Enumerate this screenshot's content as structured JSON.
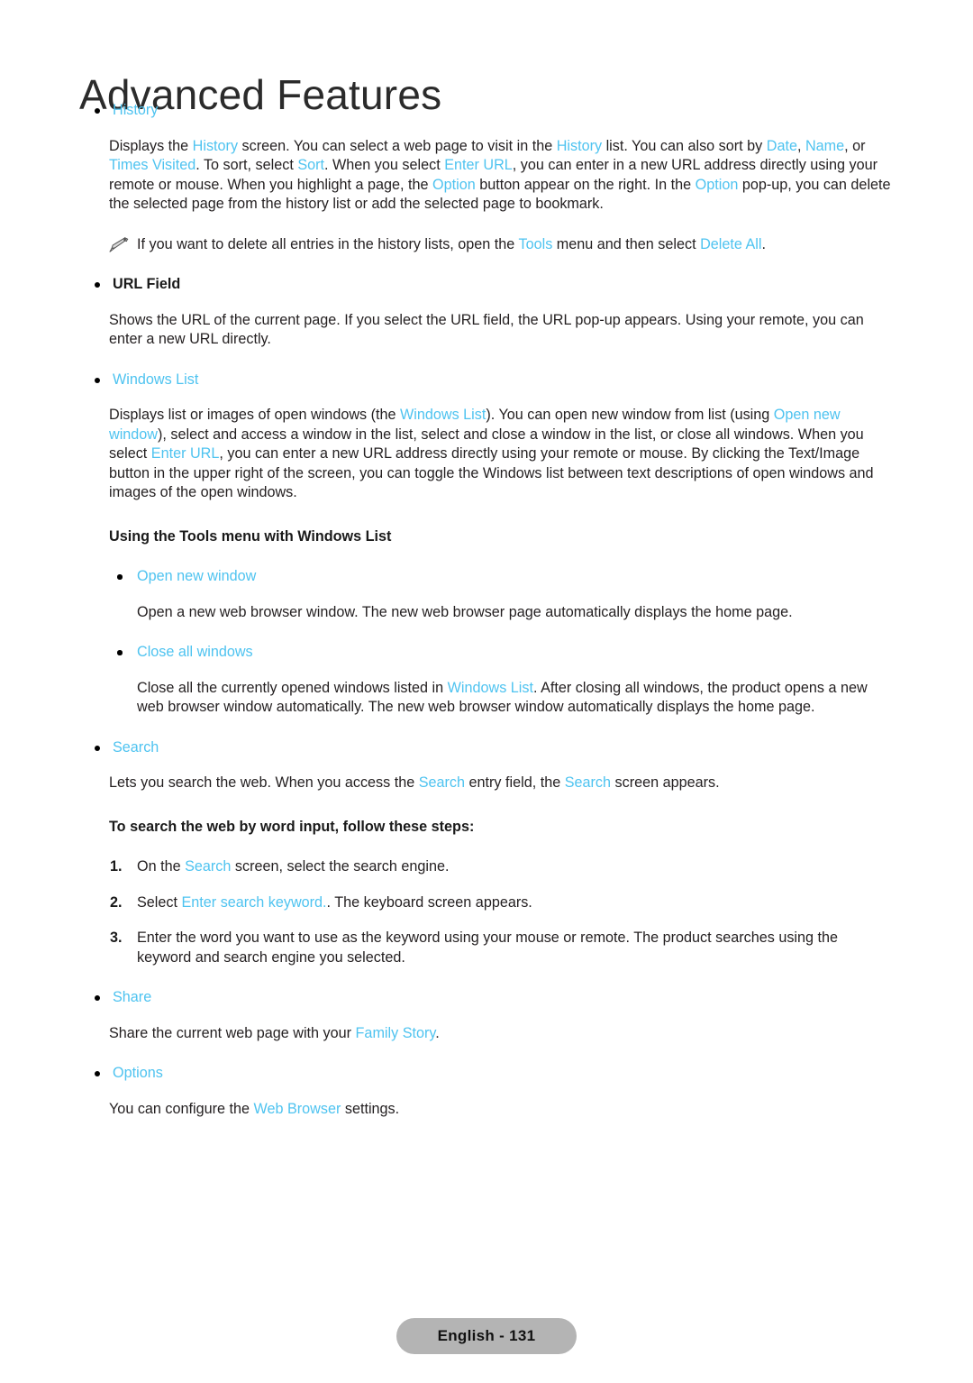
{
  "header": {
    "title": "Advanced Features"
  },
  "colors": {
    "highlight": "#4ec3f0",
    "text": "#231f20",
    "badge_bg": "#b4b4b4"
  },
  "sections": {
    "history": {
      "bullet_label": "History",
      "paragraph": {
        "p1": "Displays the ",
        "t1": "History",
        "p2": " screen. You can select a web page to visit in the ",
        "t2": "History",
        "p3": " list. You can also sort by ",
        "t3": "Date",
        "p4": ", ",
        "t4": "Name",
        "p5": ", or ",
        "t5": "Times Visited",
        "p6": ". To sort, select ",
        "t6": "Sort",
        "p7": ". When you select ",
        "t7": "Enter URL",
        "p8": ", you can enter in a new URL address directly using your remote or mouse. When you highlight a page, the ",
        "t8": "Option",
        "p9": " button appear on the right. In the ",
        "t9": "Option",
        "p10": " pop-up, you can delete the selected page from the history list or add the selected page to bookmark."
      },
      "note": {
        "n1": "If you want to delete all entries in the history lists, open the ",
        "t1": "Tools",
        "n2": " menu and then select ",
        "t2": "Delete All",
        "n3": "."
      },
      "note_icon": "pencil-icon"
    },
    "url_field": {
      "bullet_label": "URL Field",
      "paragraph": "Shows the URL of the current page. If you select the URL field, the URL pop-up appears. Using your remote, you can enter a new URL directly."
    },
    "windows_list": {
      "bullet_label": "Windows List",
      "paragraph": {
        "p1": "Displays list or images of open windows (the ",
        "t1": "Windows List",
        "p2": "). You can open new window from list (using ",
        "t2": "Open new window",
        "p3": "), select and access a window in the list, select and close a window in the list, or close all windows. When you select ",
        "t3": "Enter URL",
        "p4": ", you can enter a new URL address directly using your remote or mouse. By clicking the Text/Image button in the upper right of the screen, you can toggle the Windows list between text descriptions of open windows and images of the open windows."
      },
      "sub_heading": "Using the Tools menu with Windows List",
      "items": [
        {
          "label": "Open new window",
          "paragraph": "Open a new web browser window. The new web browser page automatically displays the home page."
        },
        {
          "label": "Close all windows",
          "paragraph": {
            "p1": "Close all the currently opened windows listed in ",
            "t1": "Windows List",
            "p2": ". After closing all windows, the product opens a new web browser window automatically. The new web browser window automatically displays the home page."
          }
        }
      ]
    },
    "search": {
      "bullet_label": "Search",
      "paragraph": {
        "p1": "Lets you search the web. When you access the ",
        "t1": "Search",
        "p2": " entry field, the ",
        "t2": "Search",
        "p3": " screen appears."
      },
      "sub_heading": "To search the web by word input, follow these steps:",
      "steps": [
        {
          "num": "1.",
          "p1": "On the ",
          "t1": "Search",
          "p2": " screen, select the search engine."
        },
        {
          "num": "2.",
          "p1": "Select ",
          "t1": "Enter search keyword.",
          "p2": ". The keyboard screen appears."
        },
        {
          "num": "3.",
          "p1": "Enter the word you want to use as the keyword using your mouse or remote. The product searches using the keyword and search engine you selected.",
          "t1": "",
          "p2": ""
        }
      ]
    },
    "share": {
      "bullet_label": "Share",
      "paragraph": {
        "p1": "Share the current web page with your ",
        "t1": "Family Story",
        "p2": "."
      }
    },
    "options": {
      "bullet_label": "Options",
      "paragraph": {
        "p1": "You can configure the ",
        "t1": "Web Browser",
        "p2": " settings."
      }
    }
  },
  "footer": {
    "page_label": "English - 131"
  }
}
